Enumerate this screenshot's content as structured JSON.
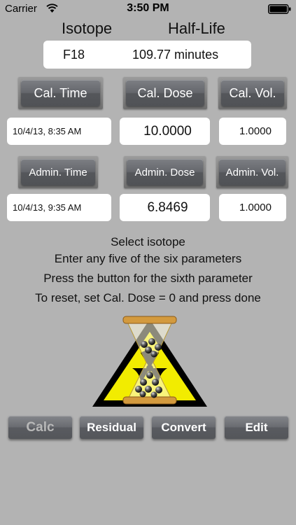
{
  "status": {
    "carrier": "Carrier",
    "time": "3:50 PM"
  },
  "header": {
    "isotope_label": "Isotope",
    "halflife_label": "Half-Life"
  },
  "isotope": {
    "name": "F18",
    "half_life": "109.77 minutes"
  },
  "calibration": {
    "time_button": "Cal. Time",
    "dose_button": "Cal. Dose",
    "volume_button": "Cal. Vol.",
    "time_value": "10/4/13, 8:35 AM",
    "dose_value": "10.0000",
    "volume_value": "1.0000"
  },
  "administration": {
    "time_button": "Admin. Time",
    "dose_button": "Admin. Dose",
    "volume_button": "Admin. Vol.",
    "time_value": "10/4/13, 9:35 AM",
    "dose_value": "6.8469",
    "volume_value": "1.0000"
  },
  "instructions": [
    "Select isotope",
    "Enter any five of the six parameters",
    "Press the button for the sixth parameter",
    "To reset, set Cal. Dose = 0 and press done"
  ],
  "toolbar": {
    "calc": "Calc",
    "residual": "Residual",
    "convert": "Convert",
    "edit": "Edit"
  },
  "colors": {
    "background": "#b3b3b3",
    "button": "#65676c",
    "field": "#ffffff",
    "hazard_yellow": "#f2ec00"
  }
}
